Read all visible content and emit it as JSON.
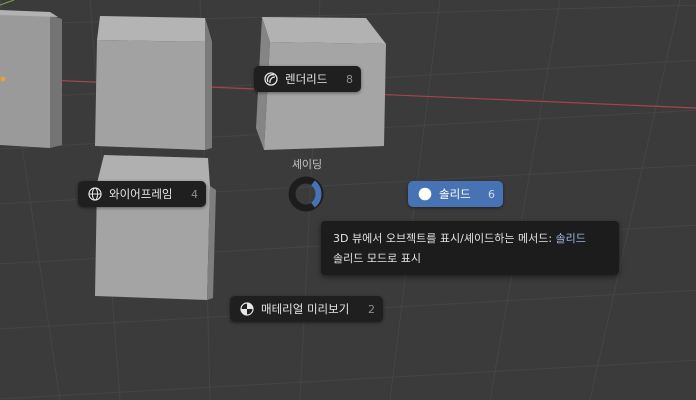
{
  "pie_menu": {
    "title": "셰이딩",
    "items": {
      "rendered": {
        "label": "렌더리드",
        "shortcut": "8",
        "icon": "rendered-sphere-icon"
      },
      "wireframe": {
        "label": "와이어프레임",
        "shortcut": "4",
        "icon": "wireframe-sphere-icon"
      },
      "solid": {
        "label": "솔리드",
        "shortcut": "6",
        "icon": "solid-sphere-icon",
        "active": true
      },
      "material": {
        "label": "매테리얼 미리보기",
        "shortcut": "2",
        "icon": "material-sphere-icon"
      }
    },
    "accent_color": "#4772b3"
  },
  "tooltip": {
    "description": "3D 뷰에서 오브젝트를 표시/셰이드하는 메서드:",
    "value": "솔리드",
    "detail": "솔리드 모드로 표시"
  },
  "viewport": {
    "background_color": "#3b3b3b",
    "x_axis_color": "#a8434b"
  }
}
